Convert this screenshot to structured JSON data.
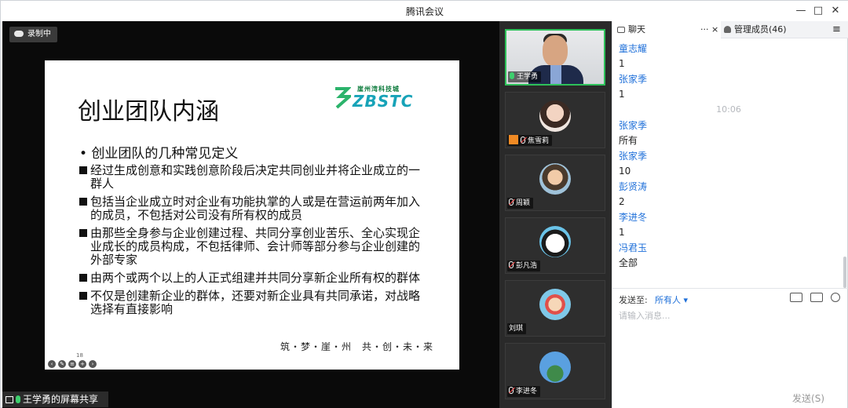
{
  "window": {
    "title": "腾讯会议"
  },
  "stage": {
    "recording_label": "录制中",
    "share_label": "王学勇的屏幕共享",
    "slide": {
      "title": "创业团队内涵",
      "logo_sub": "崖州湾科技城",
      "logo_brand": "ZBSTC",
      "main_bullet": "• 创业团队的几种常见定义",
      "items": [
        "经过生成创意和实践创意阶段后决定共同创业并将企业成立的一群人",
        "包括当企业成立时对企业有功能执掌的人或是在营运前两年加入的成员，不包括对公司没有所有权的成员",
        "由那些全身参与企业创建过程、共同分享创业苦乐、全心实现企业成长的成员构成，不包括律师、会计师等部分参与企业创建的外部专家",
        "由两个或两个以上的人正式组建并共同分享新企业所有权的群体",
        "不仅是创建新企业的群体，还要对新企业具有共同承诺，对战略选择有直接影响"
      ],
      "footer": "筑・梦・崖・州　共・创・未・来",
      "page_number": "18"
    }
  },
  "participants": [
    {
      "name": "王学勇",
      "mic": "on",
      "video": true
    },
    {
      "name": "焦雪莉",
      "mic": "off",
      "host_icon": true
    },
    {
      "name": "周颖",
      "mic": "off"
    },
    {
      "name": "彭凡浩",
      "mic": "off"
    },
    {
      "name": "刘琪",
      "mic": "none"
    },
    {
      "name": "李进冬",
      "mic": "off"
    }
  ],
  "chat": {
    "tab_chat": "聊天",
    "tab_more": "···",
    "tab_close": "×",
    "tab_members": "管理成员(46)",
    "messages": [
      {
        "type": "name",
        "text": "童志耀"
      },
      {
        "type": "text",
        "text": "1"
      },
      {
        "type": "name",
        "text": "张家季"
      },
      {
        "type": "text",
        "text": "1"
      },
      {
        "type": "time",
        "text": "10:06"
      },
      {
        "type": "name",
        "text": "张家季"
      },
      {
        "type": "text",
        "text": "所有"
      },
      {
        "type": "name",
        "text": "张家季"
      },
      {
        "type": "text",
        "text": "10"
      },
      {
        "type": "name",
        "text": "彭贤涛"
      },
      {
        "type": "text",
        "text": "2"
      },
      {
        "type": "name",
        "text": "李进冬"
      },
      {
        "type": "text",
        "text": "1"
      },
      {
        "type": "name",
        "text": "冯君玉"
      },
      {
        "type": "text",
        "text": "全部"
      }
    ],
    "send_to_label": "发送至:",
    "send_to_value": "所有人 ▾",
    "input_placeholder": "请输入消息...",
    "send_button": "发送(S)"
  },
  "colors": {
    "accent": "#1e6fd9",
    "active_border": "#2ec15a"
  }
}
